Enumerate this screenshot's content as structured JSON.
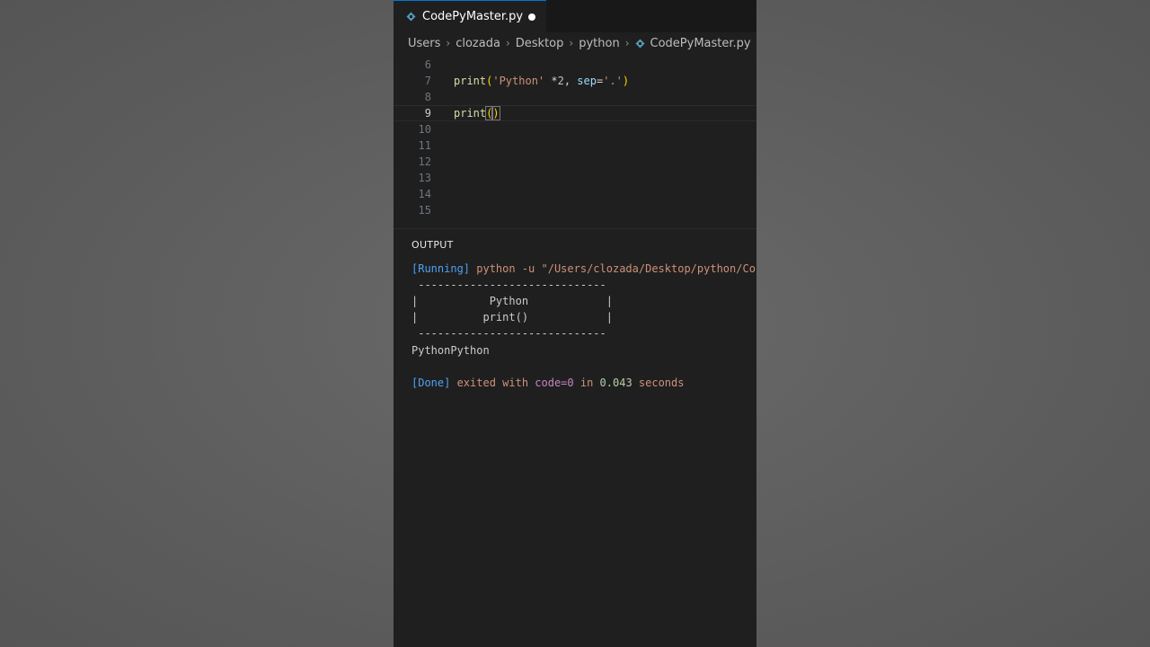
{
  "tab": {
    "title": "CodePyMaster.py"
  },
  "breadcrumb": [
    "Users",
    "clozada",
    "Desktop",
    "python",
    "CodePyMaster.py"
  ],
  "code": {
    "lines": [
      {
        "number": "6",
        "text": ""
      },
      {
        "number": "7",
        "text": "print('Python' *2, sep='.')"
      },
      {
        "number": "8",
        "text": ""
      },
      {
        "number": "9",
        "text": "print()"
      },
      {
        "number": "10",
        "text": ""
      },
      {
        "number": "11",
        "text": ""
      },
      {
        "number": "12",
        "text": ""
      },
      {
        "number": "13",
        "text": ""
      },
      {
        "number": "14",
        "text": ""
      },
      {
        "number": "15",
        "text": ""
      }
    ],
    "line7": {
      "fn": "print",
      "open": "(",
      "str": "'Python'",
      "op": " *",
      "num": "2",
      "comma": ", ",
      "param": "sep",
      "eq": "=",
      "str2": "'.'",
      "close": ")"
    },
    "line9": {
      "fn": "print",
      "open": "(",
      "close": ")"
    }
  },
  "panel": {
    "title": "OUTPUT",
    "running_tag": "[Running]",
    "running_cmd": " python -u \"/Users/clozada/Desktop/python/Co",
    "box_top": " -----------------------------",
    "box_line1": "|           Python            |",
    "box_line2": "|          print()            |",
    "box_bottom": " -----------------------------",
    "result": "PythonPython",
    "done_tag": "[Done]",
    "done_exited": " exited with ",
    "done_code": "code=0",
    "done_in": " in ",
    "done_time": "0.043",
    "done_seconds": " seconds"
  },
  "colors": {
    "accent": "#0078d4",
    "python_icon": "#519aba"
  }
}
